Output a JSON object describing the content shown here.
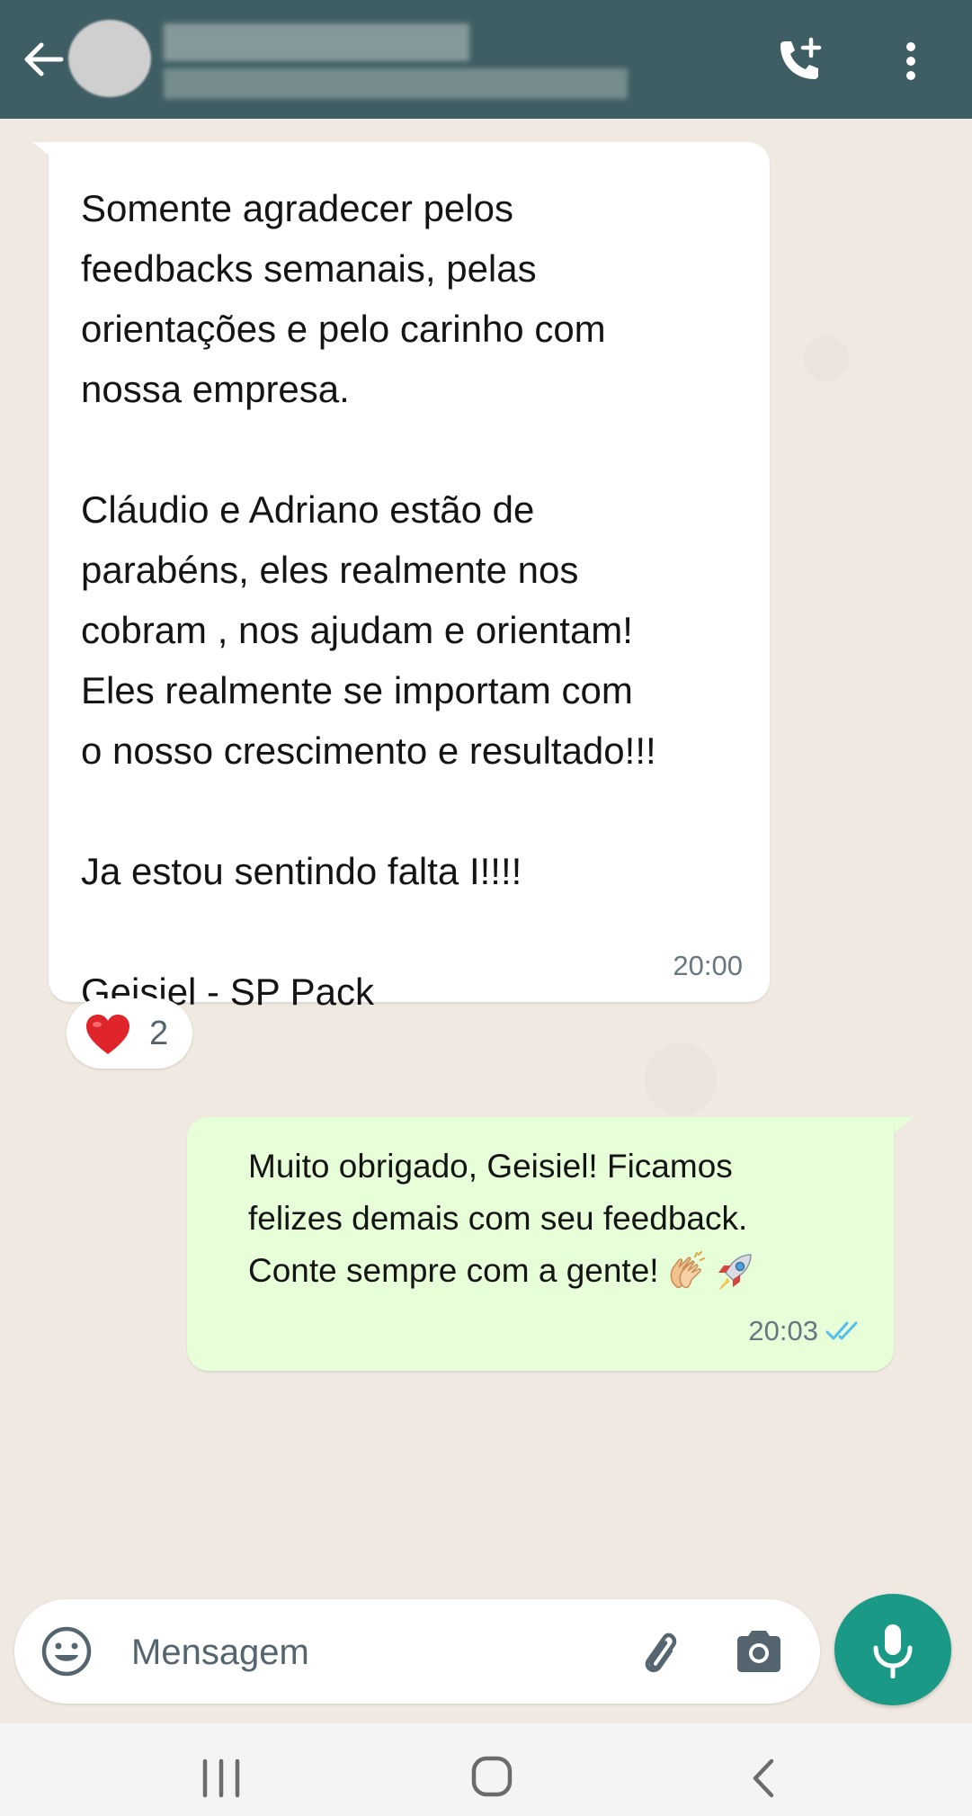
{
  "header": {
    "back_icon": "arrow-left-icon",
    "call_icon": "phone-plus-icon",
    "menu_icon": "more-vertical-icon"
  },
  "messages": [
    {
      "direction": "incoming",
      "text": "Somente agradecer pelos\nfeedbacks semanais, pelas\norientações e pelo carinho com\nnossa empresa.\n\nCláudio e Adriano estão de\nparabéns, eles realmente nos\ncobram , nos ajudam e orientam!\nEles realmente se importam com\no nosso crescimento e resultado!!!\n\nJa estou sentindo falta I!!!!\n\nGeisiel - SP Pack",
      "time": "20:00",
      "reaction": {
        "emoji": "heart-icon",
        "count": "2"
      }
    },
    {
      "direction": "outgoing",
      "lines": [
        "Muito obrigado, Geisiel! Ficamos",
        "felizes demais com seu feedback.",
        "Conte sempre com a gente!"
      ],
      "emojis": [
        "clapping-hands-icon",
        "rocket-icon"
      ],
      "time": "20:03",
      "status": "read"
    }
  ],
  "composer": {
    "placeholder": "Mensagem"
  },
  "colors": {
    "header": "#3f5e63",
    "background": "#efe9e1",
    "incoming_bubble": "#ffffff",
    "outgoing_bubble": "#e6ffd9",
    "accent": "#1a9a86",
    "read_ticks": "#53bdeb"
  }
}
